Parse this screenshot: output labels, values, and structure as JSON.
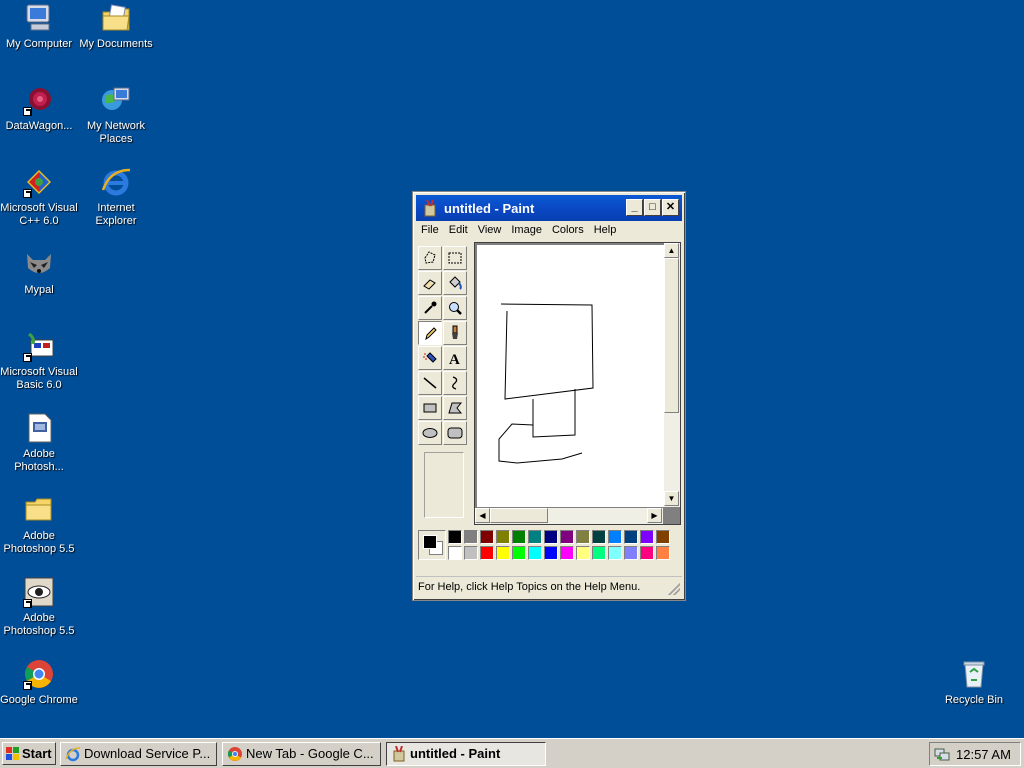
{
  "desktop": {
    "icons": [
      {
        "label": "My Computer"
      },
      {
        "label": "My Documents"
      },
      {
        "label": "DataWagon..."
      },
      {
        "label": "My Network Places"
      },
      {
        "label": "Microsoft Visual C++ 6.0"
      },
      {
        "label": "Internet Explorer"
      },
      {
        "label": "Mypal"
      },
      {
        "label": "Microsoft Visual Basic 6.0"
      },
      {
        "label": "Adobe Photosh..."
      },
      {
        "label": "Adobe Photoshop 5.5"
      },
      {
        "label": "Adobe Photoshop 5.5"
      },
      {
        "label": "Google Chrome"
      },
      {
        "label": "Recycle Bin"
      }
    ]
  },
  "paint": {
    "title": "untitled - Paint",
    "menu": [
      "File",
      "Edit",
      "View",
      "Image",
      "Colors",
      "Help"
    ],
    "tools": [
      "free-form-select",
      "select",
      "eraser",
      "fill-with-color",
      "pick-color",
      "magnifier",
      "pencil",
      "brush",
      "airbrush",
      "text",
      "line",
      "curve",
      "rectangle",
      "polygon",
      "ellipse",
      "rounded-rectangle"
    ],
    "selected_tool": "pencil",
    "foreground_color": "#000000",
    "background_color": "#ffffff",
    "palette_top": [
      "#000000",
      "#808080",
      "#800000",
      "#808000",
      "#008000",
      "#008080",
      "#000080",
      "#800080",
      "#808040",
      "#004040",
      "#0080ff",
      "#004080",
      "#8000ff",
      "#804000"
    ],
    "palette_bottom": [
      "#ffffff",
      "#c0c0c0",
      "#ff0000",
      "#ffff00",
      "#00ff00",
      "#00ffff",
      "#0000ff",
      "#ff00ff",
      "#ffff80",
      "#00ff80",
      "#80ffff",
      "#8080ff",
      "#ff0080",
      "#ff8040"
    ],
    "status": "For Help, click Help Topics on the Help Menu."
  },
  "taskbar": {
    "start_label": "Start",
    "buttons": [
      {
        "label": "Download Service P...",
        "active": false
      },
      {
        "label": "New Tab - Google C...",
        "active": false
      },
      {
        "label": "untitled - Paint",
        "active": true
      }
    ],
    "clock": "12:57 AM"
  }
}
